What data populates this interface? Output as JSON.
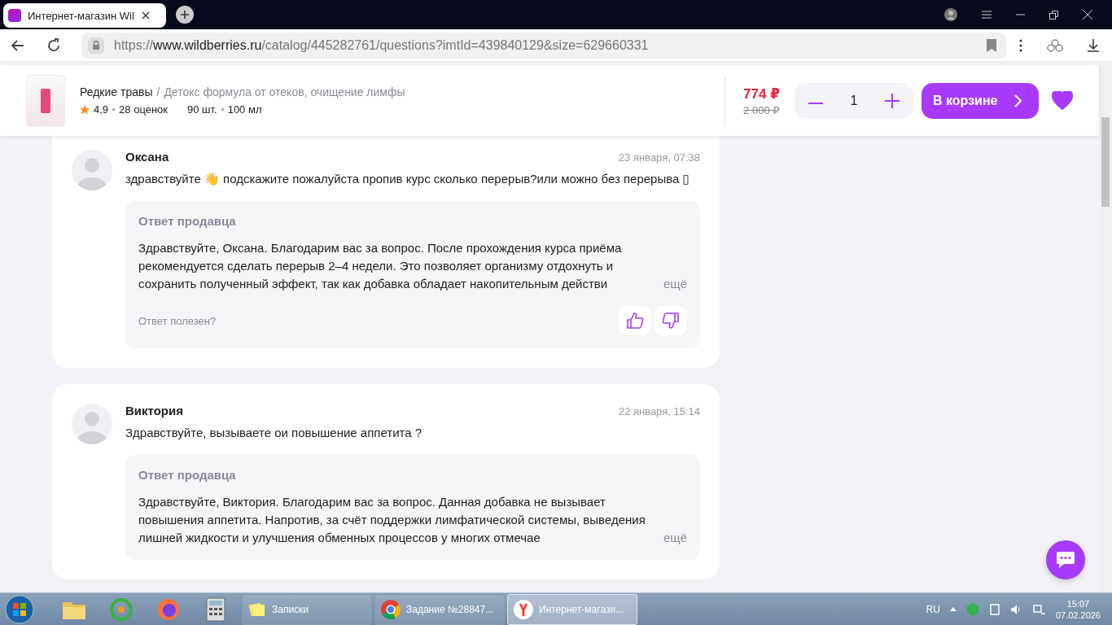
{
  "browser": {
    "tab_title": "Интернет-магазин Wil",
    "url": {
      "scheme": "https://",
      "host": "www.wildberries.ru",
      "path": "/catalog/445282761/questions?imtId=439840129&size=629660331"
    }
  },
  "product": {
    "brand": "Редкие травы",
    "separator": "/",
    "name": "Детокс формула от отеков, очищение лимфы",
    "rating": "4,9",
    "reviews": "28 оценок",
    "pack": "90 шт.",
    "volume": "100 мл",
    "price": "774 ₽",
    "old_price": "2 000 ₽",
    "quantity": "1",
    "cart_button": "В корзине",
    "favorite": true
  },
  "questions": [
    {
      "author": "Оксана",
      "date": "23 января, 07:38",
      "text": "здравствуйте 👋 подскажите пожалуйста пропив курс сколько перерыв?или можно без перерыва ▯",
      "answer": {
        "title": "Ответ продавца",
        "text": "Здравствуйте, Оксана. Благодарим вас за вопрос. После прохождения курса приёма рекомендуется сделать перерыв 2–4 недели. Это позволяет организму отдохнуть и сохранить полученный эффект, так как добавка обладает накопительным действи",
        "more": "ещё",
        "helpful_prompt": "Ответ полезен?"
      }
    },
    {
      "author": "Виктория",
      "date": "22 января, 15:14",
      "text": "Здравствуйте, вызываете ои повышение аппетита ?",
      "answer": {
        "title": "Ответ продавца",
        "text": "Здравствуйте, Виктория. Благодарим вас за вопрос. Данная добавка не вызывает повышения аппетита. Напротив, за счёт поддержки лимфатической системы, выведения лишней жидкости и улучшения обменных процессов у многих отмечае",
        "more": "ещё"
      }
    }
  ],
  "taskbar": {
    "windows": [
      {
        "label": "Записки",
        "kind": "notes",
        "selected": false
      },
      {
        "label": "Задание №28847...",
        "kind": "chrome",
        "selected": false
      },
      {
        "label": "Интернет-магази...",
        "kind": "yandex",
        "selected": true
      }
    ],
    "language": "RU",
    "time": "15:07",
    "date": "07.02.2026"
  }
}
